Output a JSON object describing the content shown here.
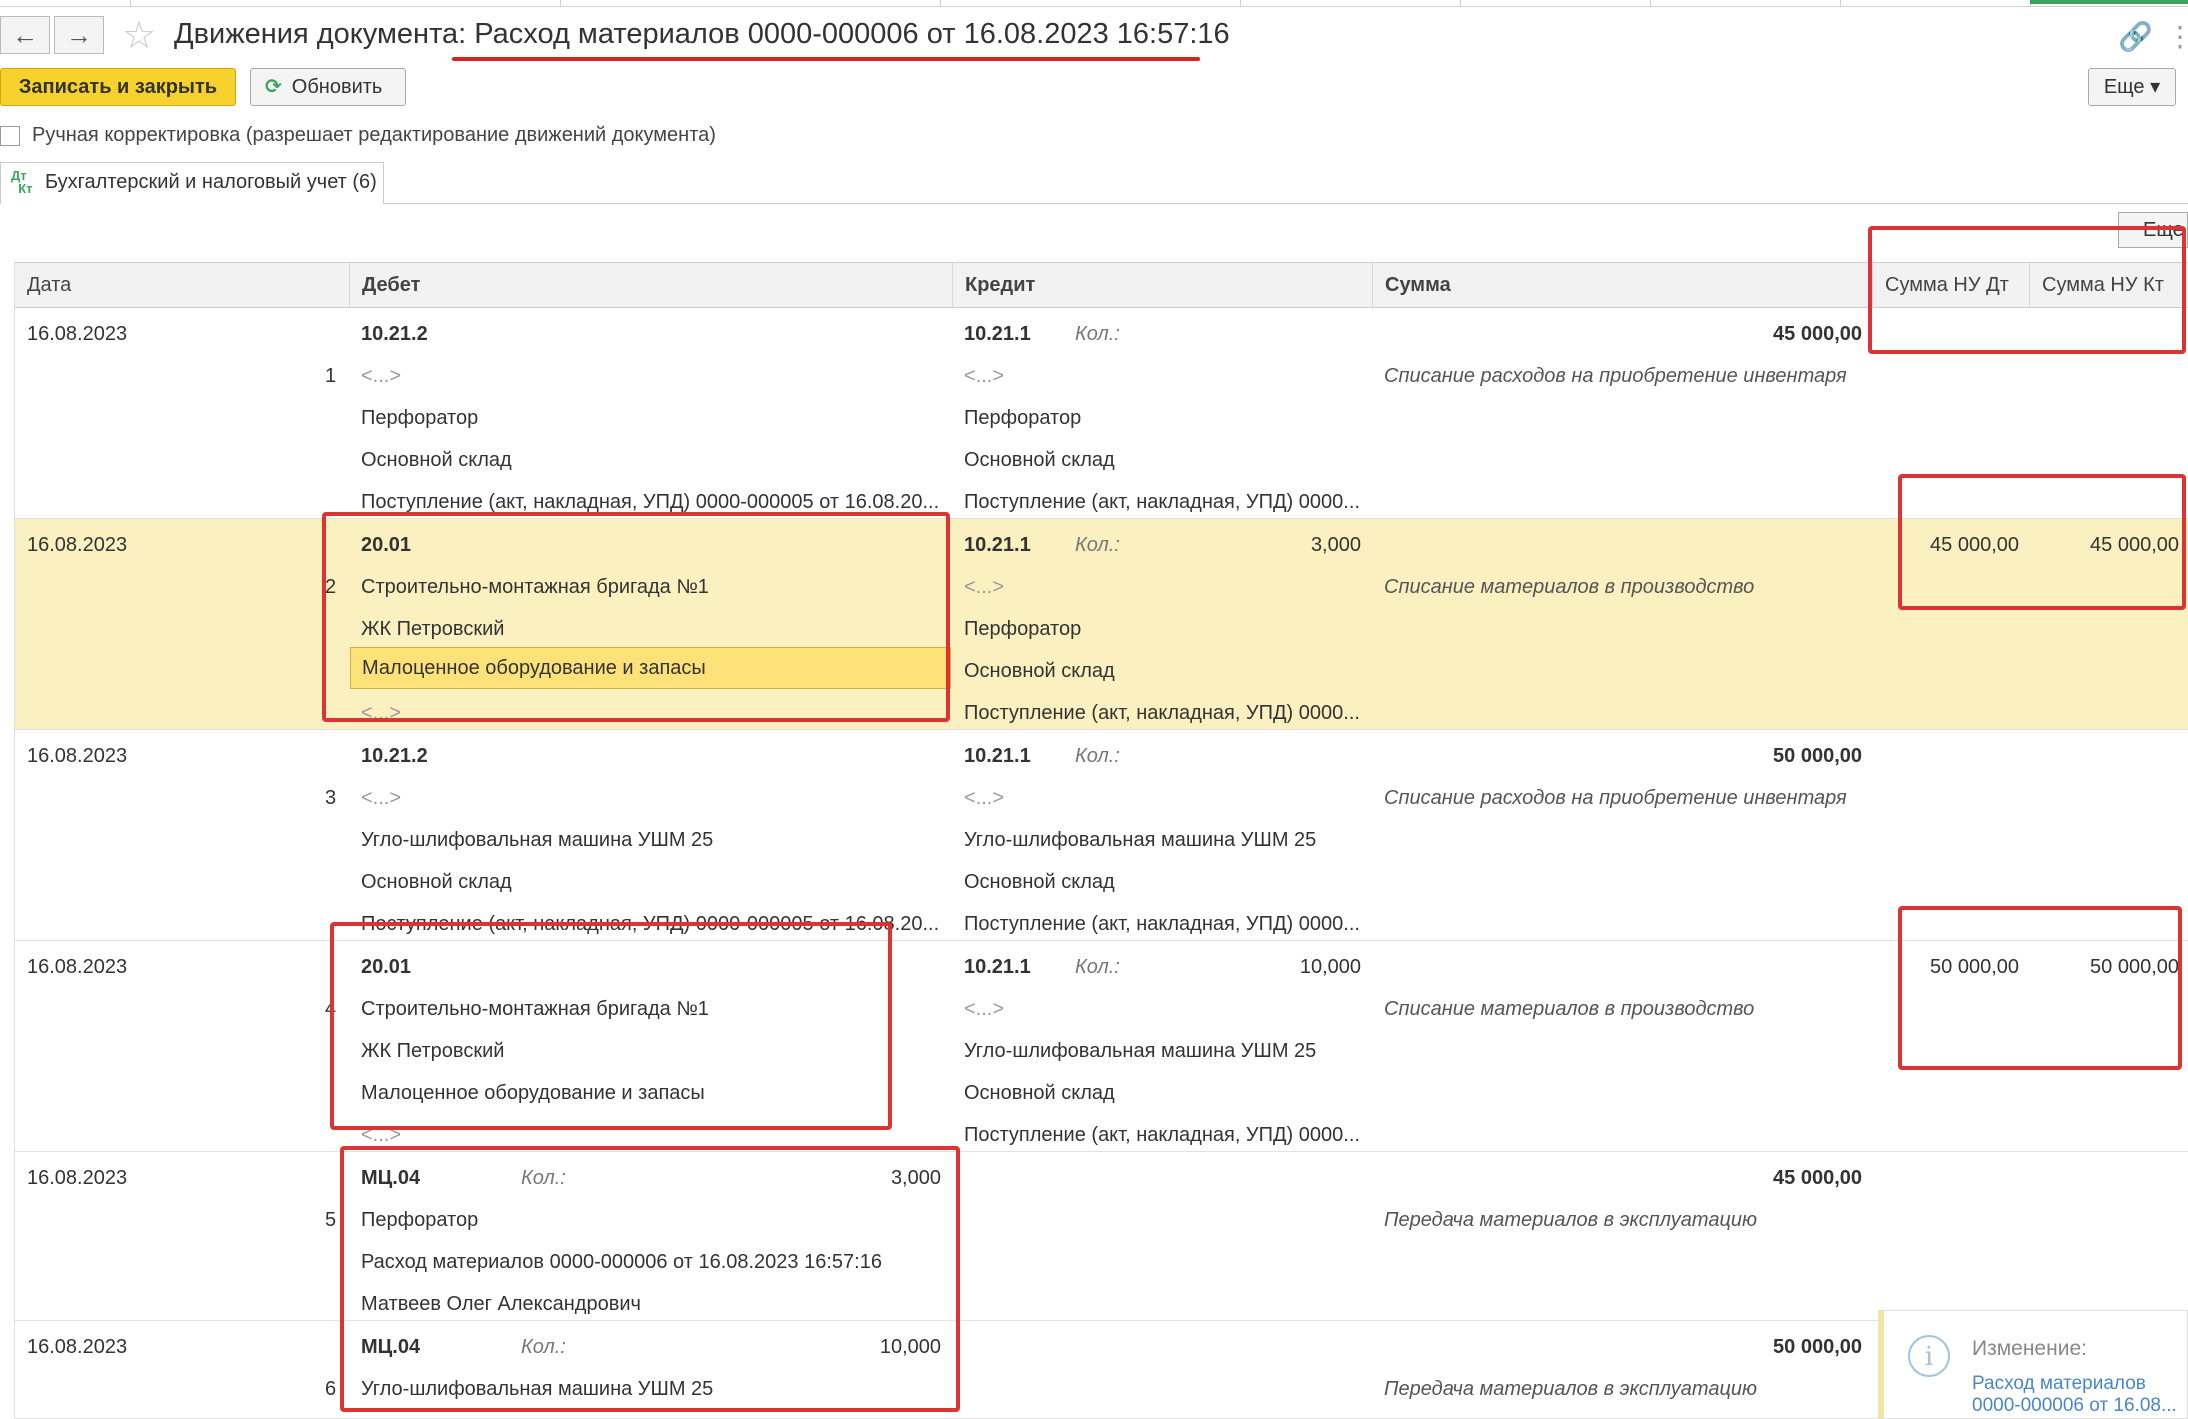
{
  "window": {
    "title_prefix": "Движения документа: ",
    "title_doc": "Расход материалов 0000-000006 от 16.08.2023 16:57:16"
  },
  "toolbar": {
    "save_close": "Записать и закрыть",
    "refresh": "Обновить",
    "more": "Еще",
    "table_more": "Еще"
  },
  "manual_edit": {
    "label": "Ручная корректировка (разрешает редактирование движений документа)",
    "checked": false
  },
  "tab": {
    "icon_top": "Дт",
    "icon_bottom": "Кт",
    "label": "Бухгалтерский и налоговый учет (6)"
  },
  "columns": {
    "date": "Дата",
    "debit": "Дебет",
    "credit": "Кредит",
    "sum": "Сумма",
    "nu_dt": "Сумма НУ Дт",
    "nu_kt": "Сумма НУ Кт"
  },
  "kol_label": "Кол.:",
  "rows": [
    {
      "date": "16.08.2023",
      "num": "1",
      "debit": [
        "10.21.2",
        "<...>",
        "Перфоратор",
        "Основной склад",
        "Поступление (акт, накладная, УПД) 0000-000005 от 16.08.20..."
      ],
      "credit": [
        "10.21.1",
        "<...>",
        "Перфоратор",
        "Основной склад",
        "Поступление (акт, накладная, УПД) 0000..."
      ],
      "sum": "45 000,00",
      "content": "Списание расходов на приобретение инвентаря"
    },
    {
      "date": "16.08.2023",
      "num": "2",
      "debit": [
        "20.01",
        "Строительно-монтажная бригада №1",
        "ЖК Петровский",
        "Малоценное оборудование и запасы",
        "<...>"
      ],
      "credit": [
        "10.21.1",
        "<...>",
        "Перфоратор",
        "Основной склад",
        "Поступление (акт, накладная, УПД) 0000..."
      ],
      "credit_qty": "3,000",
      "content": "Списание материалов в производство",
      "nu_dt": "45 000,00",
      "nu_kt": "45 000,00"
    },
    {
      "date": "16.08.2023",
      "num": "3",
      "debit": [
        "10.21.2",
        "<...>",
        "Угло-шлифовальная машина УШМ 25",
        "Основной склад",
        "Поступление (акт, накладная, УПД) 0000-000005 от 16.08.20..."
      ],
      "credit": [
        "10.21.1",
        "<...>",
        "Угло-шлифовальная машина УШМ 25",
        "Основной склад",
        "Поступление (акт, накладная, УПД) 0000..."
      ],
      "sum": "50 000,00",
      "content": "Списание расходов на приобретение инвентаря"
    },
    {
      "date": "16.08.2023",
      "num": "4",
      "debit": [
        "20.01",
        "Строительно-монтажная бригада №1",
        "ЖК Петровский",
        "Малоценное оборудование и запасы",
        "<...>"
      ],
      "credit": [
        "10.21.1",
        "<...>",
        "Угло-шлифовальная машина УШМ 25",
        "Основной склад",
        "Поступление (акт, накладная, УПД) 0000..."
      ],
      "credit_qty": "10,000",
      "content": "Списание материалов в производство",
      "nu_dt": "50 000,00",
      "nu_kt": "50 000,00"
    },
    {
      "date": "16.08.2023",
      "num": "5",
      "debit": [
        "МЦ.04",
        "Перфоратор",
        "Расход материалов 0000-000006 от 16.08.2023 16:57:16",
        "Матвеев Олег Александрович"
      ],
      "debit_qty": "3,000",
      "sum": "45 000,00",
      "content": "Передача материалов в эксплуатацию"
    },
    {
      "date": "16.08.2023",
      "num": "6",
      "debit": [
        "МЦ.04",
        "Угло-шлифовальная машина УШМ 25"
      ],
      "debit_qty": "10,000",
      "sum": "50 000,00",
      "content": "Передача материалов в эксплуатацию"
    }
  ],
  "notification": {
    "title": "Изменение:",
    "line1": "Расход материалов",
    "line2": "0000-000006 от 16.08..."
  },
  "colors": {
    "accent_yellow": "#f7d12d",
    "selection": "#fbf0c0",
    "annotation_red": "#d33333",
    "green": "#3da35d"
  }
}
